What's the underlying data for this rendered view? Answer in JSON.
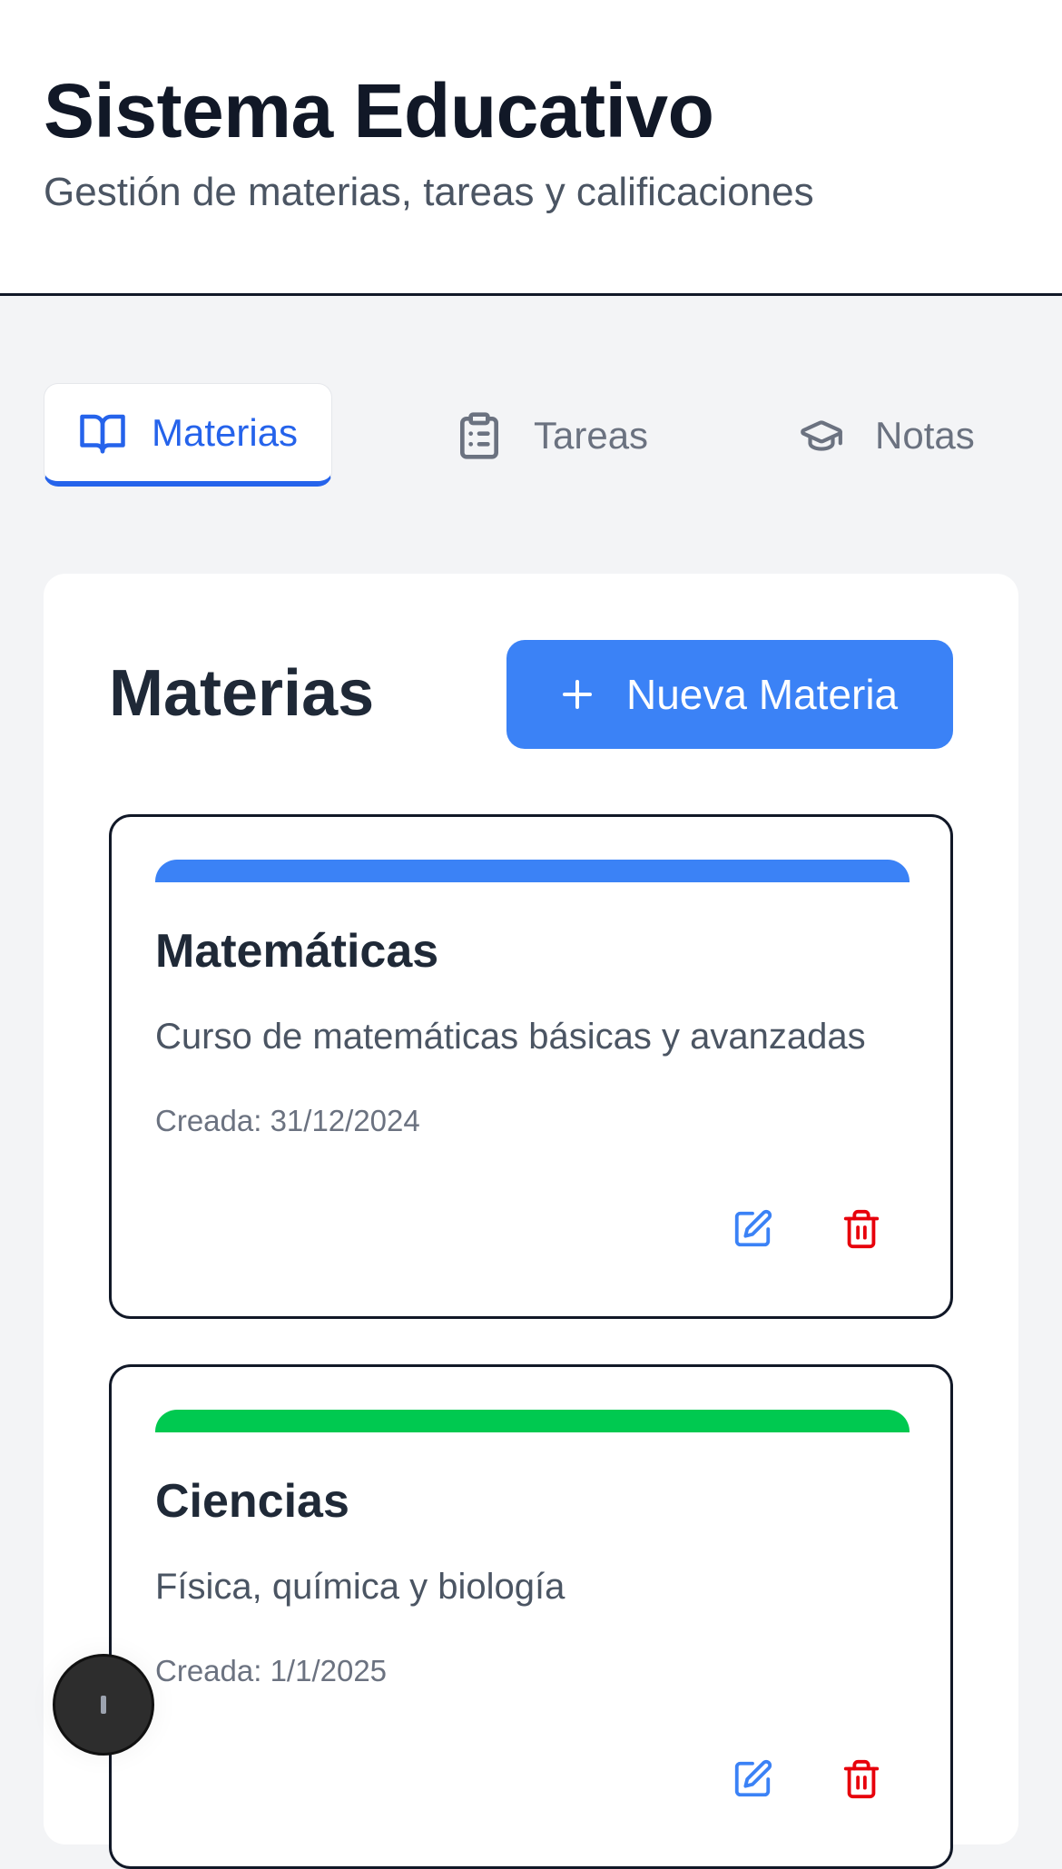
{
  "header": {
    "title": "Sistema Educativo",
    "subtitle": "Gestión de materias, tareas y calificaciones"
  },
  "tabs": [
    {
      "label": "Materias",
      "icon": "book-open-icon",
      "active": true
    },
    {
      "label": "Tareas",
      "icon": "clipboard-list-icon",
      "active": false
    },
    {
      "label": "Notas",
      "icon": "graduation-cap-icon",
      "active": false
    }
  ],
  "panel": {
    "title": "Materias",
    "new_button_label": "Nueva Materia"
  },
  "subjects": [
    {
      "name": "Matemáticas",
      "description": "Curso de matemáticas básicas y avanzadas",
      "created": "Creada: 31/12/2024",
      "color": "#3b82f6"
    },
    {
      "name": "Ciencias",
      "description": "Física, química y biología",
      "created": "Creada: 1/1/2025",
      "color": "#00c950"
    }
  ],
  "colors": {
    "accent": "#2563eb",
    "primary_button": "#3b82f6",
    "edit": "#3b82f6",
    "delete": "#e7000b"
  },
  "floating_button": {
    "icon": "dev-tools-indicator-icon"
  }
}
